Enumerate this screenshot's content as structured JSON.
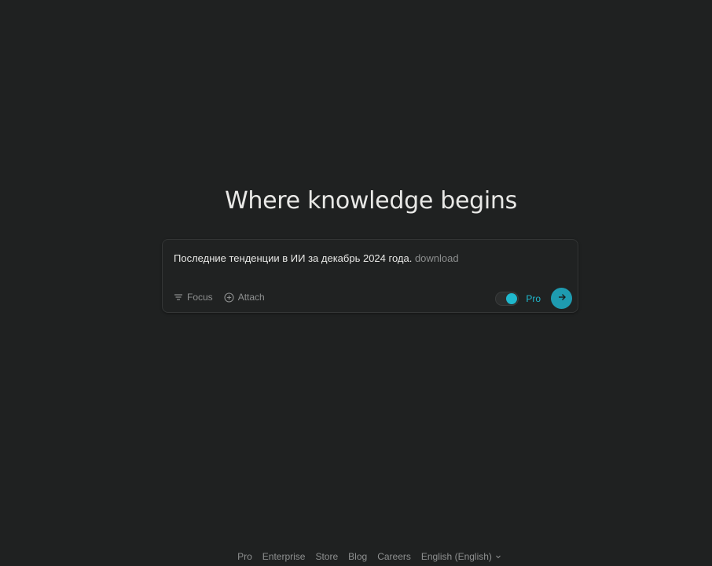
{
  "headline": "Where knowledge begins",
  "search": {
    "query": "Последние тенденции в ИИ за декабрь 2024 года.",
    "suggestion": "download",
    "focus_label": "Focus",
    "attach_label": "Attach",
    "pro_label": "Pro",
    "pro_enabled": true
  },
  "footer": {
    "links": [
      "Pro",
      "Enterprise",
      "Store",
      "Blog",
      "Careers"
    ],
    "language": "English (English)"
  },
  "colors": {
    "background": "#1f2121",
    "accent": "#1fb8cd",
    "text": "#e8e8e6",
    "muted": "#8e9090"
  }
}
